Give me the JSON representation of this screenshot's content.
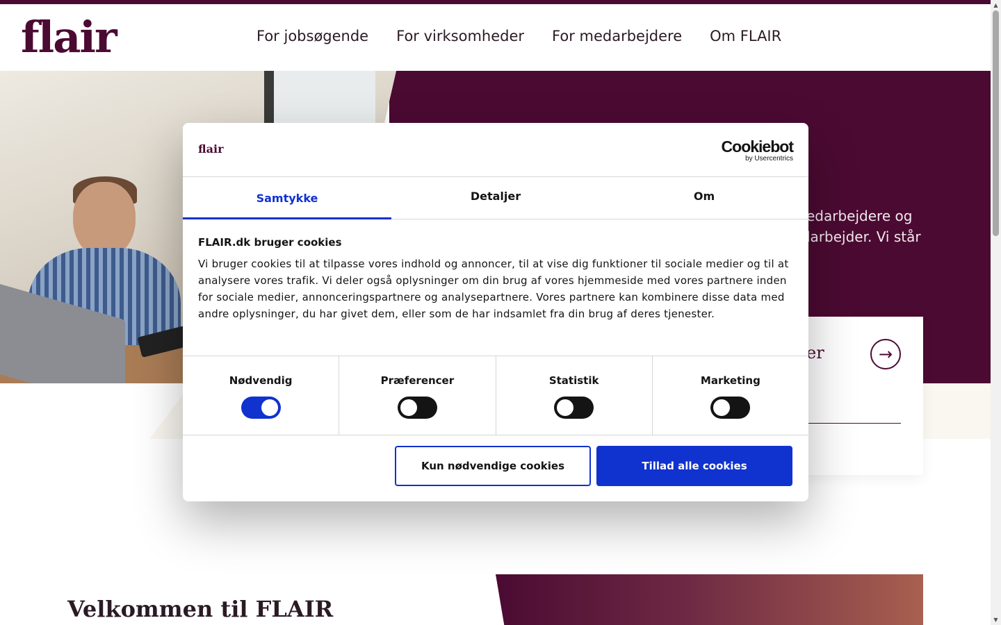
{
  "brand": {
    "logo_text": "flair",
    "primary_color": "#4b0a32"
  },
  "nav": {
    "items": [
      {
        "label": "For jobsøgende"
      },
      {
        "label": "For virksomheder"
      },
      {
        "label": "For medarbejdere"
      },
      {
        "label": "Om FLAIR"
      }
    ]
  },
  "hero": {
    "text_visible": "edarbejdere og\nlarbejder. Vi står",
    "card_title_fragment": "er",
    "card_icon": "arrow-right-circle-icon"
  },
  "section": {
    "welcome_heading": "Velkommen til FLAIR"
  },
  "cookie_dialog": {
    "site_logo": "flair",
    "provider_name": "Cookiebot",
    "provider_sub": "by Usercentrics",
    "tabs": [
      {
        "label": "Samtykke",
        "active": true
      },
      {
        "label": "Detaljer",
        "active": false
      },
      {
        "label": "Om",
        "active": false
      }
    ],
    "title": "FLAIR.dk bruger cookies",
    "body": "Vi bruger cookies til at tilpasse vores indhold og annoncer, til at vise dig funktioner til sociale medier og til at analysere vores trafik. Vi deler også oplysninger om din brug af vores hjemmeside med vores partnere inden for sociale medier, annonceringspartnere og analysepartnere. Vores partnere kan kombinere disse data med andre oplysninger, du har givet dem, eller som de har indsamlet fra din brug af deres tjenester.",
    "categories": [
      {
        "label": "Nødvendig",
        "enabled": true
      },
      {
        "label": "Præferencer",
        "enabled": false
      },
      {
        "label": "Statistik",
        "enabled": false
      },
      {
        "label": "Marketing",
        "enabled": false
      }
    ],
    "buttons": {
      "necessary_only": "Kun nødvendige cookies",
      "allow_all": "Tillad alle cookies"
    },
    "accent_color": "#1032cf"
  }
}
